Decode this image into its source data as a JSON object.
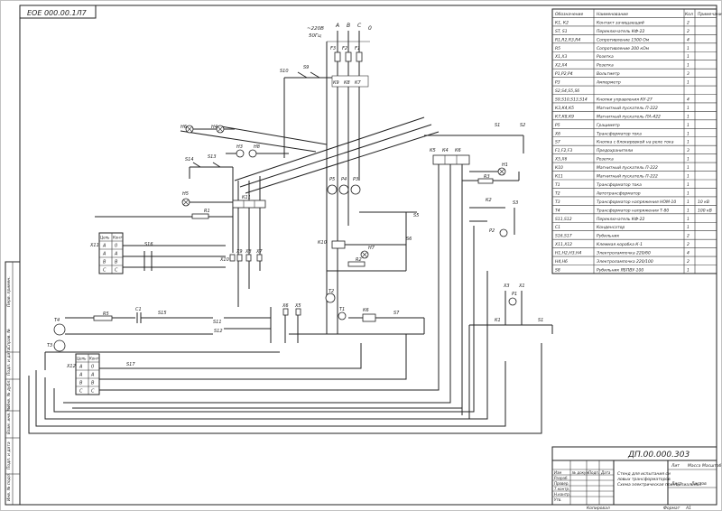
{
  "drawing": {
    "stamp_top": "ЕОЕ 000.00.1Л7",
    "title_number": "ДП.00.000.303",
    "title_desc": "Стенд для испытания силовых трансформаторов. Схема электрическая принципиальная",
    "format": "А1",
    "sheet": "Лист",
    "sheets": "Листов",
    "copied": "Копировал",
    "format_label": "Формат"
  },
  "bom": {
    "headers": [
      "Обозначение",
      "Наименование",
      "Кол",
      "Примечание"
    ],
    "rows": [
      [
        "К1, К2",
        "Контакт зачищающий",
        "2",
        ""
      ],
      [
        "ST, S1",
        "Переключатель КФ-22",
        "2",
        ""
      ],
      [
        "R1,R2,R3,R4",
        "Сопротивление 1500 Ом",
        "4",
        ""
      ],
      [
        "R5",
        "Сопротивление 200 кОм",
        "1",
        ""
      ],
      [
        "Х1,Х3",
        "Розетка",
        "1",
        ""
      ],
      [
        "Х2,Х4",
        "Розетка",
        "1",
        ""
      ],
      [
        "P1,P2,P4",
        "Вольтметр",
        "3",
        ""
      ],
      [
        "P3",
        "Амперметр",
        "1",
        ""
      ],
      [
        "S2,S4,S5,S6",
        "",
        "",
        ""
      ],
      [
        "S9,S10,S13,S14",
        "Кнопки управления КУ-27",
        "4",
        ""
      ],
      [
        "К3,К4,К5",
        "Магнитный пускатель П-222",
        "1",
        ""
      ],
      [
        "К7,К8,К9",
        "Магнитный пускатель ПА-422",
        "1",
        ""
      ],
      [
        "P5",
        "Грациметр",
        "1",
        ""
      ],
      [
        "Х6",
        "Трансформатор тока",
        "1",
        ""
      ],
      [
        "S7",
        "Кнопка с блокировкой на реле тока",
        "1",
        ""
      ],
      [
        "F1,F2,F3",
        "Предохранители",
        "3",
        ""
      ],
      [
        "Х5,Х6",
        "Розетка",
        "1",
        ""
      ],
      [
        "К10",
        "Магнитный пускатель П-222",
        "1",
        ""
      ],
      [
        "К11",
        "Магнитный пускатель П-222",
        "1",
        ""
      ],
      [
        "Т1",
        "Трансформатор тока",
        "1",
        ""
      ],
      [
        "Т2",
        "Автотрансформатор",
        "1",
        ""
      ],
      [
        "Т3",
        "Трансформатор напряжения НОМ-10",
        "1",
        "10 кВ"
      ],
      [
        "Т4",
        "Трансформатор напряжения Т-80",
        "1",
        "100 кВ"
      ],
      [
        "S11,S12",
        "Переключатель КФ-22",
        "1",
        ""
      ],
      [
        "С1",
        "Конденсатор",
        "1",
        ""
      ],
      [
        "S16,S17",
        "Рубильник",
        "2",
        ""
      ],
      [
        "Х11,Х12",
        "Клеммая коробка К-1",
        "2",
        ""
      ],
      [
        "Н1,Н2,Н3,Н4",
        "Электролампочка 220/60",
        "4",
        ""
      ],
      [
        "Н4,Н6",
        "Электролампочка 220/100",
        "2",
        ""
      ],
      [
        "S8",
        "Рубильник ЯБПВУ-100",
        "1",
        ""
      ]
    ]
  },
  "supply": {
    "voltage": "~220В",
    "freq": "50Гц",
    "phases": [
      "А",
      "В",
      "С",
      "0"
    ]
  },
  "labels": {
    "F1": "F1",
    "F2": "F2",
    "F3": "F3",
    "K7": "К7",
    "K8": "К8",
    "K9": "К9",
    "S9": "S9",
    "S10": "S10",
    "S13": "S13",
    "S14": "S14",
    "H6": "Н6",
    "H4": "Н4",
    "H3": "Н3",
    "H8": "Н8",
    "H5": "Н5",
    "R1": "R1",
    "R5": "R5",
    "R2": "R2",
    "R3": "R3",
    "K11": "К11",
    "K10": "К10",
    "X10": "Х10",
    "X9": "Х9",
    "X8": "Х8",
    "X7": "Х7",
    "X6": "Х6",
    "X5": "Х5",
    "P1": "P1",
    "P2": "P2",
    "P3": "P3",
    "P4": "P4",
    "P5": "P5",
    "T1": "Т1",
    "T2": "Т2",
    "T3": "Т3",
    "T4": "Т4",
    "C1": "С1",
    "S5": "S5",
    "S6": "S6",
    "S7": "S7",
    "S11": "S11",
    "S12": "S12",
    "S15": "S15",
    "S16": "S16",
    "S17": "S17",
    "K1": "К1",
    "K2": "К2",
    "K4": "К4",
    "K5": "К5",
    "K6": "К6",
    "S1": "S1",
    "S2": "S2",
    "S3": "S3",
    "H1": "Н1",
    "X1": "Х1",
    "X2": "Х2",
    "X3": "Х3",
    "H7": "Н7",
    "X11": "Х11",
    "X12": "Х12"
  },
  "phase_box": {
    "header": [
      "Цепь",
      "Конт"
    ],
    "rows": [
      [
        "А",
        "0"
      ],
      [
        "А",
        "А"
      ],
      [
        "В",
        "В"
      ],
      [
        "С",
        "С"
      ]
    ]
  },
  "titleblock": {
    "left_labels": [
      "Изм",
      "Лист",
      "№ докум.",
      "Подп.",
      "Дата"
    ],
    "roles": [
      "Разраб.",
      "Провер.",
      "Т.контр.",
      "Н.контр.",
      "Утв."
    ],
    "lit": "Лит",
    "mass": "Масса",
    "scale": "Масштаб",
    "side": [
      "Перв. примен.",
      "Справ. №",
      "Подп. и дата",
      "Инв. № дубл.",
      "Взам. инв. №",
      "Подп. и дата",
      "Инв. № подл."
    ]
  }
}
